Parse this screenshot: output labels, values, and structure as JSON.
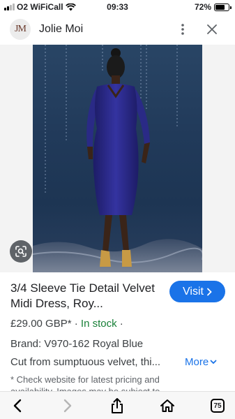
{
  "status_bar": {
    "carrier": "O2 WiFiCall",
    "time": "09:33",
    "battery": "72%",
    "battery_level": 0.72
  },
  "header": {
    "logo_text": "JM",
    "site_name": "Jolie Moi"
  },
  "product": {
    "title": "3/4 Sleeve Tie Detail Velvet Midi Dress, Roy...",
    "visit_label": "Visit",
    "price": "£29.00 GBP*",
    "separator": "·",
    "stock": "In stock",
    "brand": "Brand: V970-162 Royal Blue",
    "description": "Cut from sumptuous velvet, thi...",
    "more_label": "More",
    "note": "* Check website for latest pricing and availability. Images may be subject to"
  },
  "toolbar": {
    "tabs_count": "75"
  },
  "colors": {
    "accent": "#1a73e8",
    "in_stock": "#188038",
    "dress": "#2b2a8c"
  }
}
